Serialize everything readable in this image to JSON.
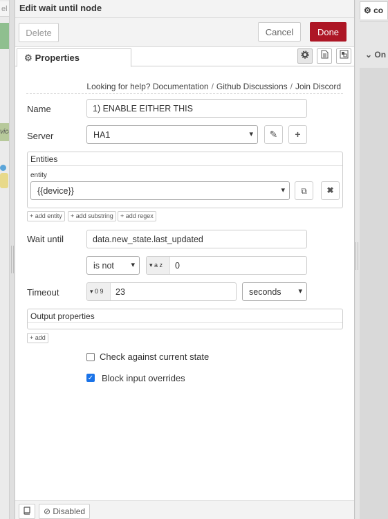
{
  "left_strip": {
    "tab_fragment": "el",
    "node_fragment": "vice"
  },
  "tray": {
    "title": "Edit wait until node",
    "delete_label": "Delete",
    "cancel_label": "Cancel",
    "done_label": "Done",
    "tab_properties": "Properties"
  },
  "help": {
    "prefix": "Looking for help?",
    "links": [
      "Documentation",
      "Github Discussions",
      "Join Discord"
    ],
    "separator": "/"
  },
  "form": {
    "name_label": "Name",
    "name_value": "1) ENABLE EITHER THIS",
    "server_label": "Server",
    "server_value": "HA1",
    "entities_label": "Entities",
    "entity_sublabel": "entity",
    "entity_value": "{{device}}",
    "add_entity": "add entity",
    "add_substring": "add substring",
    "add_regex": "add regex",
    "wait_until_label": "Wait until",
    "wait_until_value": "data.new_state.last_updated",
    "comparator_value": "is not",
    "compare_type": "a z",
    "compare_value": "0",
    "timeout_label": "Timeout",
    "timeout_type": "0 9",
    "timeout_value": "23",
    "timeout_unit": "seconds",
    "output_properties_label": "Output properties",
    "add_output": "add",
    "check_current_state_label": "Check against current state",
    "check_current_state": false,
    "block_input_overrides_label": "Block input overrides",
    "block_input_overrides": true
  },
  "footer": {
    "disabled_label": "Disabled"
  },
  "right_panel": {
    "tab_fragment": "co",
    "section_fragment": "On"
  },
  "colors": {
    "done": "#ad1625",
    "checkbox": "#1a73e8"
  }
}
